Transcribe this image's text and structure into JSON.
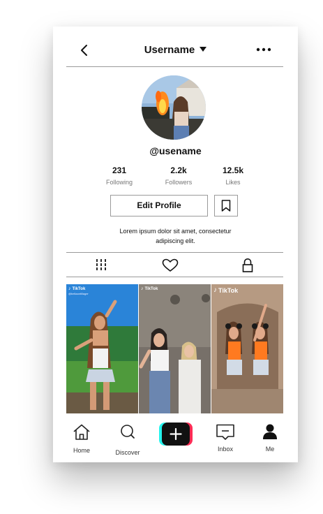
{
  "header": {
    "title": "Username"
  },
  "profile": {
    "handle": "@usename"
  },
  "stats": [
    {
      "value": "231",
      "label": "Following"
    },
    {
      "value": "2.2k",
      "label": "Followers"
    },
    {
      "value": "12.5k",
      "label": "Likes"
    }
  ],
  "actions": {
    "edit_label": "Edit Profile"
  },
  "bio": {
    "line1": "Lorem ipsum dolor sit amet, consectetur",
    "line2": "adipiscing elit."
  },
  "tabs": [
    "grid-icon",
    "heart-icon",
    "lock-icon"
  ],
  "videos": [
    {
      "watermark": "TikTok",
      "subtitle": "@bellaantillager"
    },
    {
      "watermark": "TikTok",
      "subtitle": ""
    },
    {
      "watermark": "TikTok",
      "subtitle": ""
    }
  ],
  "nav": [
    {
      "label": "Home",
      "icon": "home-icon"
    },
    {
      "label": "Discover",
      "icon": "search-icon"
    },
    {
      "label": "",
      "icon": "plus-icon"
    },
    {
      "label": "Inbox",
      "icon": "inbox-icon"
    },
    {
      "label": "Me",
      "icon": "person-icon"
    }
  ],
  "colors": {
    "accent_cyan": "#25f4ee",
    "accent_red": "#fe2c55",
    "divider": "#9a9a9a"
  }
}
